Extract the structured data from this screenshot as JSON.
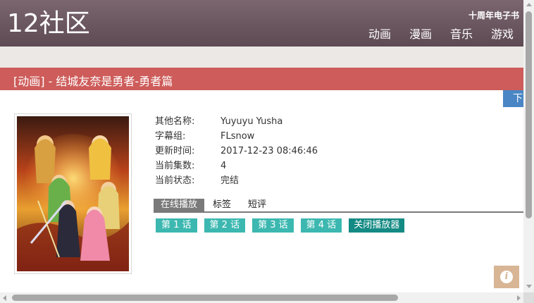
{
  "header": {
    "logo": "12社区",
    "promo": "十周年电子书",
    "nav": [
      "动画",
      "漫画",
      "音乐",
      "游戏"
    ]
  },
  "title": "[动画] - 结城友奈是勇者-勇者篇",
  "side_button": "下",
  "poster": {
    "alt_icon": "anime-poster-image"
  },
  "info": {
    "rows": [
      {
        "key": "其他名称:",
        "value": "Yuyuyu Yusha"
      },
      {
        "key": "字幕组:",
        "value": "FLsnow"
      },
      {
        "key": "更新时间:",
        "value": "2017-12-23 08:46:46"
      },
      {
        "key": "当前集数:",
        "value": "4"
      },
      {
        "key": "当前状态:",
        "value": "完结"
      }
    ]
  },
  "tabs": [
    "在线播放",
    "标签",
    "短评"
  ],
  "episodes": [
    "第 1 话",
    "第 2 话",
    "第 3 话",
    "第 4 话"
  ],
  "close_player": "关闭播放器",
  "info_icon": "i",
  "colors": {
    "header": "#6b565f",
    "title_bar": "#cd5c5a",
    "episode": "#3cb8b0",
    "close": "#138a83",
    "side_button": "#4a86c5"
  }
}
